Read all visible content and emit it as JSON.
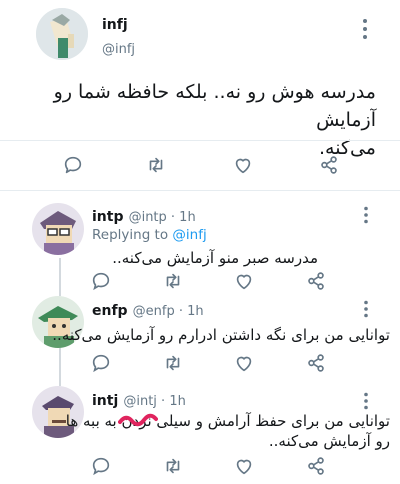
{
  "main_tweet": {
    "name": "infj",
    "handle": "@infj",
    "text_line1": "مدرسه هوش رو نه.. بلکه حافظه شما رو آزمایش",
    "text_line2": "می‌کنه."
  },
  "replies": [
    {
      "name": "intp",
      "meta": "@intp · 1h",
      "replying_prefix": "Replying to ",
      "replying_handle": "@infj",
      "text": "مدرسه صبر منو آزمایش می‌کنه.."
    },
    {
      "name": "enfp",
      "meta": "@enfp · 1h",
      "text": "توانایی من برای نگه داشتن ادرارم رو آزمایش می‌کنه.."
    },
    {
      "name": "intj",
      "meta": "@intj · 1h",
      "text_line1": "توانایی من برای حفظ آرامش و سیلی نزدن به ببه ها",
      "text_line2": "رو آزمایش می‌کنه.."
    }
  ],
  "icons": {
    "reply": "reply-icon",
    "retweet": "retweet-icon",
    "like": "heart-icon",
    "share": "share-icon",
    "more": "more-vertical-icon"
  },
  "colors": {
    "icon_gray": "#657786",
    "link_blue": "#1d9bf0",
    "scribble_pink": "#e0245e"
  }
}
